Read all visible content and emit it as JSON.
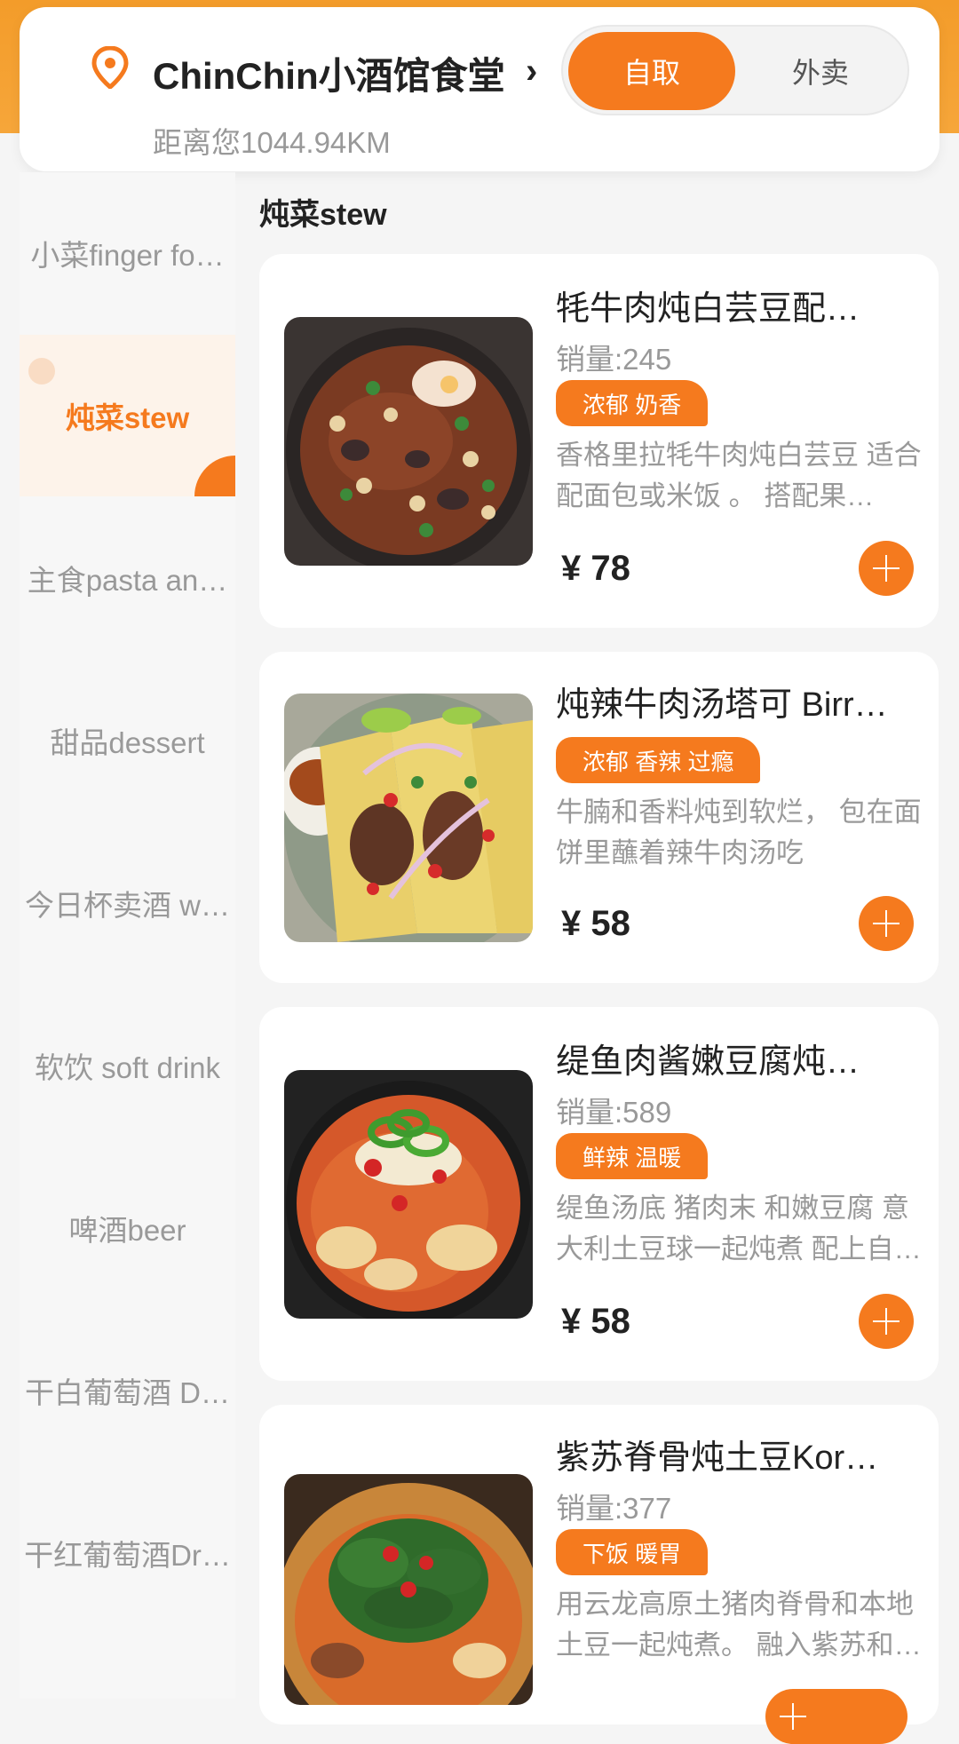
{
  "store": {
    "name": "ChinChin小酒馆食堂",
    "distance": "距离您1044.94KM",
    "modes": [
      "自取",
      "外卖"
    ],
    "active_mode": "自取"
  },
  "sidebar": {
    "items": [
      {
        "label": "小菜finger fo…"
      },
      {
        "label": "炖菜stew",
        "active": true
      },
      {
        "label": "主食pasta an…"
      },
      {
        "label": "甜品dessert"
      },
      {
        "label": "今日杯卖酒 w…"
      },
      {
        "label": "软饮 soft drink"
      },
      {
        "label": "啤酒beer"
      },
      {
        "label": "干白葡萄酒 D…"
      },
      {
        "label": "干红葡萄酒Dr…"
      }
    ]
  },
  "section": {
    "title": "炖菜stew"
  },
  "dishes": [
    {
      "name": "牦牛肉炖白芸豆配…",
      "sales": "销量:245",
      "tag": "浓郁 奶香",
      "desc": "香格里拉牦牛肉炖白芸豆 适合配面包或米饭 。 搭配果…",
      "price": "¥ 78"
    },
    {
      "name": "炖辣牛肉汤塔可 Birr…",
      "sales": "",
      "tag": "浓郁 香辣 过瘾",
      "desc": "牛腩和香料炖到软烂， 包在面饼里蘸着辣牛肉汤吃",
      "price": "¥ 58"
    },
    {
      "name": "缇鱼肉酱嫩豆腐炖…",
      "sales": "销量:589",
      "tag": "鲜辣 温暖",
      "desc": "缇鱼汤底 猪肉末 和嫩豆腐 意大利土豆球一起炖煮 配上自…",
      "price": "¥ 58"
    },
    {
      "name": "紫苏脊骨炖土豆Kor…",
      "sales": "销量:377",
      "tag": "下饭 暖胃",
      "desc": "用云龙高原土猪肉脊骨和本地土豆一起炖煮。 融入紫苏和…",
      "price": ""
    }
  ],
  "colors": {
    "accent": "#f57a1e",
    "header_band": "#f39c2a"
  }
}
